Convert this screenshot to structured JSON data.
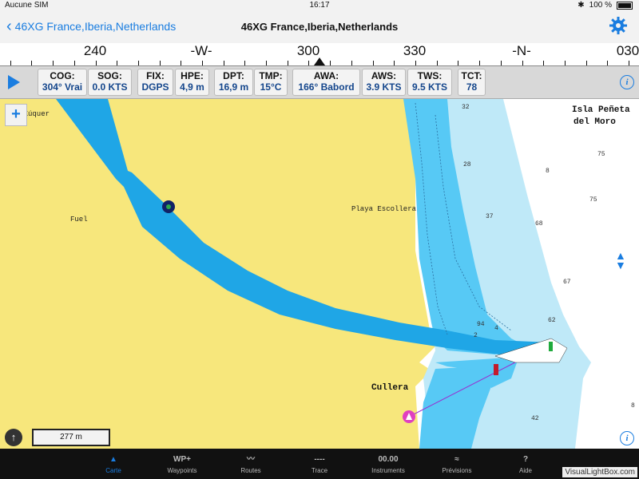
{
  "status": {
    "carrier": "Aucune SIM",
    "time": "16:17",
    "battery": "100 %"
  },
  "nav": {
    "back_label": "46XG France,Iberia,Netherlands",
    "title": "46XG France,Iberia,Netherlands"
  },
  "compass": {
    "labels": [
      "240",
      "-W-",
      "300",
      "330",
      "-N-",
      "030"
    ]
  },
  "instruments": [
    {
      "key": "COG:",
      "value": "304° Vrai"
    },
    {
      "key": "SOG:",
      "value": "0.0 KTS"
    },
    {
      "key": "FIX:",
      "value": "DGPS"
    },
    {
      "key": "HPE:",
      "value": "4,9 m"
    },
    {
      "key": "DPT:",
      "value": "16,9 m"
    },
    {
      "key": "TMP:",
      "value": "15°C"
    },
    {
      "key": "AWA:",
      "value": "166° Babord"
    },
    {
      "key": "AWS:",
      "value": "3.9 KTS"
    },
    {
      "key": "TWS:",
      "value": "9.5 KTS"
    },
    {
      "key": "TCT:",
      "value": "78"
    }
  ],
  "map": {
    "labels": {
      "top_left": "del Xúquer",
      "fuel": "Fuel",
      "playa": "Playa Escollera",
      "cullera": "Cullera",
      "isla_1": "Isla Peñeta",
      "isla_2": "del Moro"
    },
    "depths": [
      "32",
      "28",
      "37",
      "68",
      "8",
      "75",
      "75",
      "67",
      "62",
      "94",
      "4",
      "2",
      "42",
      "8"
    ],
    "scale": "277 m",
    "colors": {
      "land": "#f7e77c",
      "shallow": "#57c9f5",
      "deep": "#bfe9f8",
      "channel": "#1aa1e0"
    }
  },
  "tabs": [
    {
      "icon": "▲",
      "label": "Carte"
    },
    {
      "icon": "WP+",
      "label": "Waypoints"
    },
    {
      "icon": "〰",
      "label": "Routes"
    },
    {
      "icon": "----",
      "label": "Trace"
    },
    {
      "icon": "00.00",
      "label": "Instruments"
    },
    {
      "icon": "≈",
      "label": "Prévisions"
    },
    {
      "icon": "?",
      "label": "Aide"
    }
  ],
  "watermark": "VisualLightBox.com"
}
